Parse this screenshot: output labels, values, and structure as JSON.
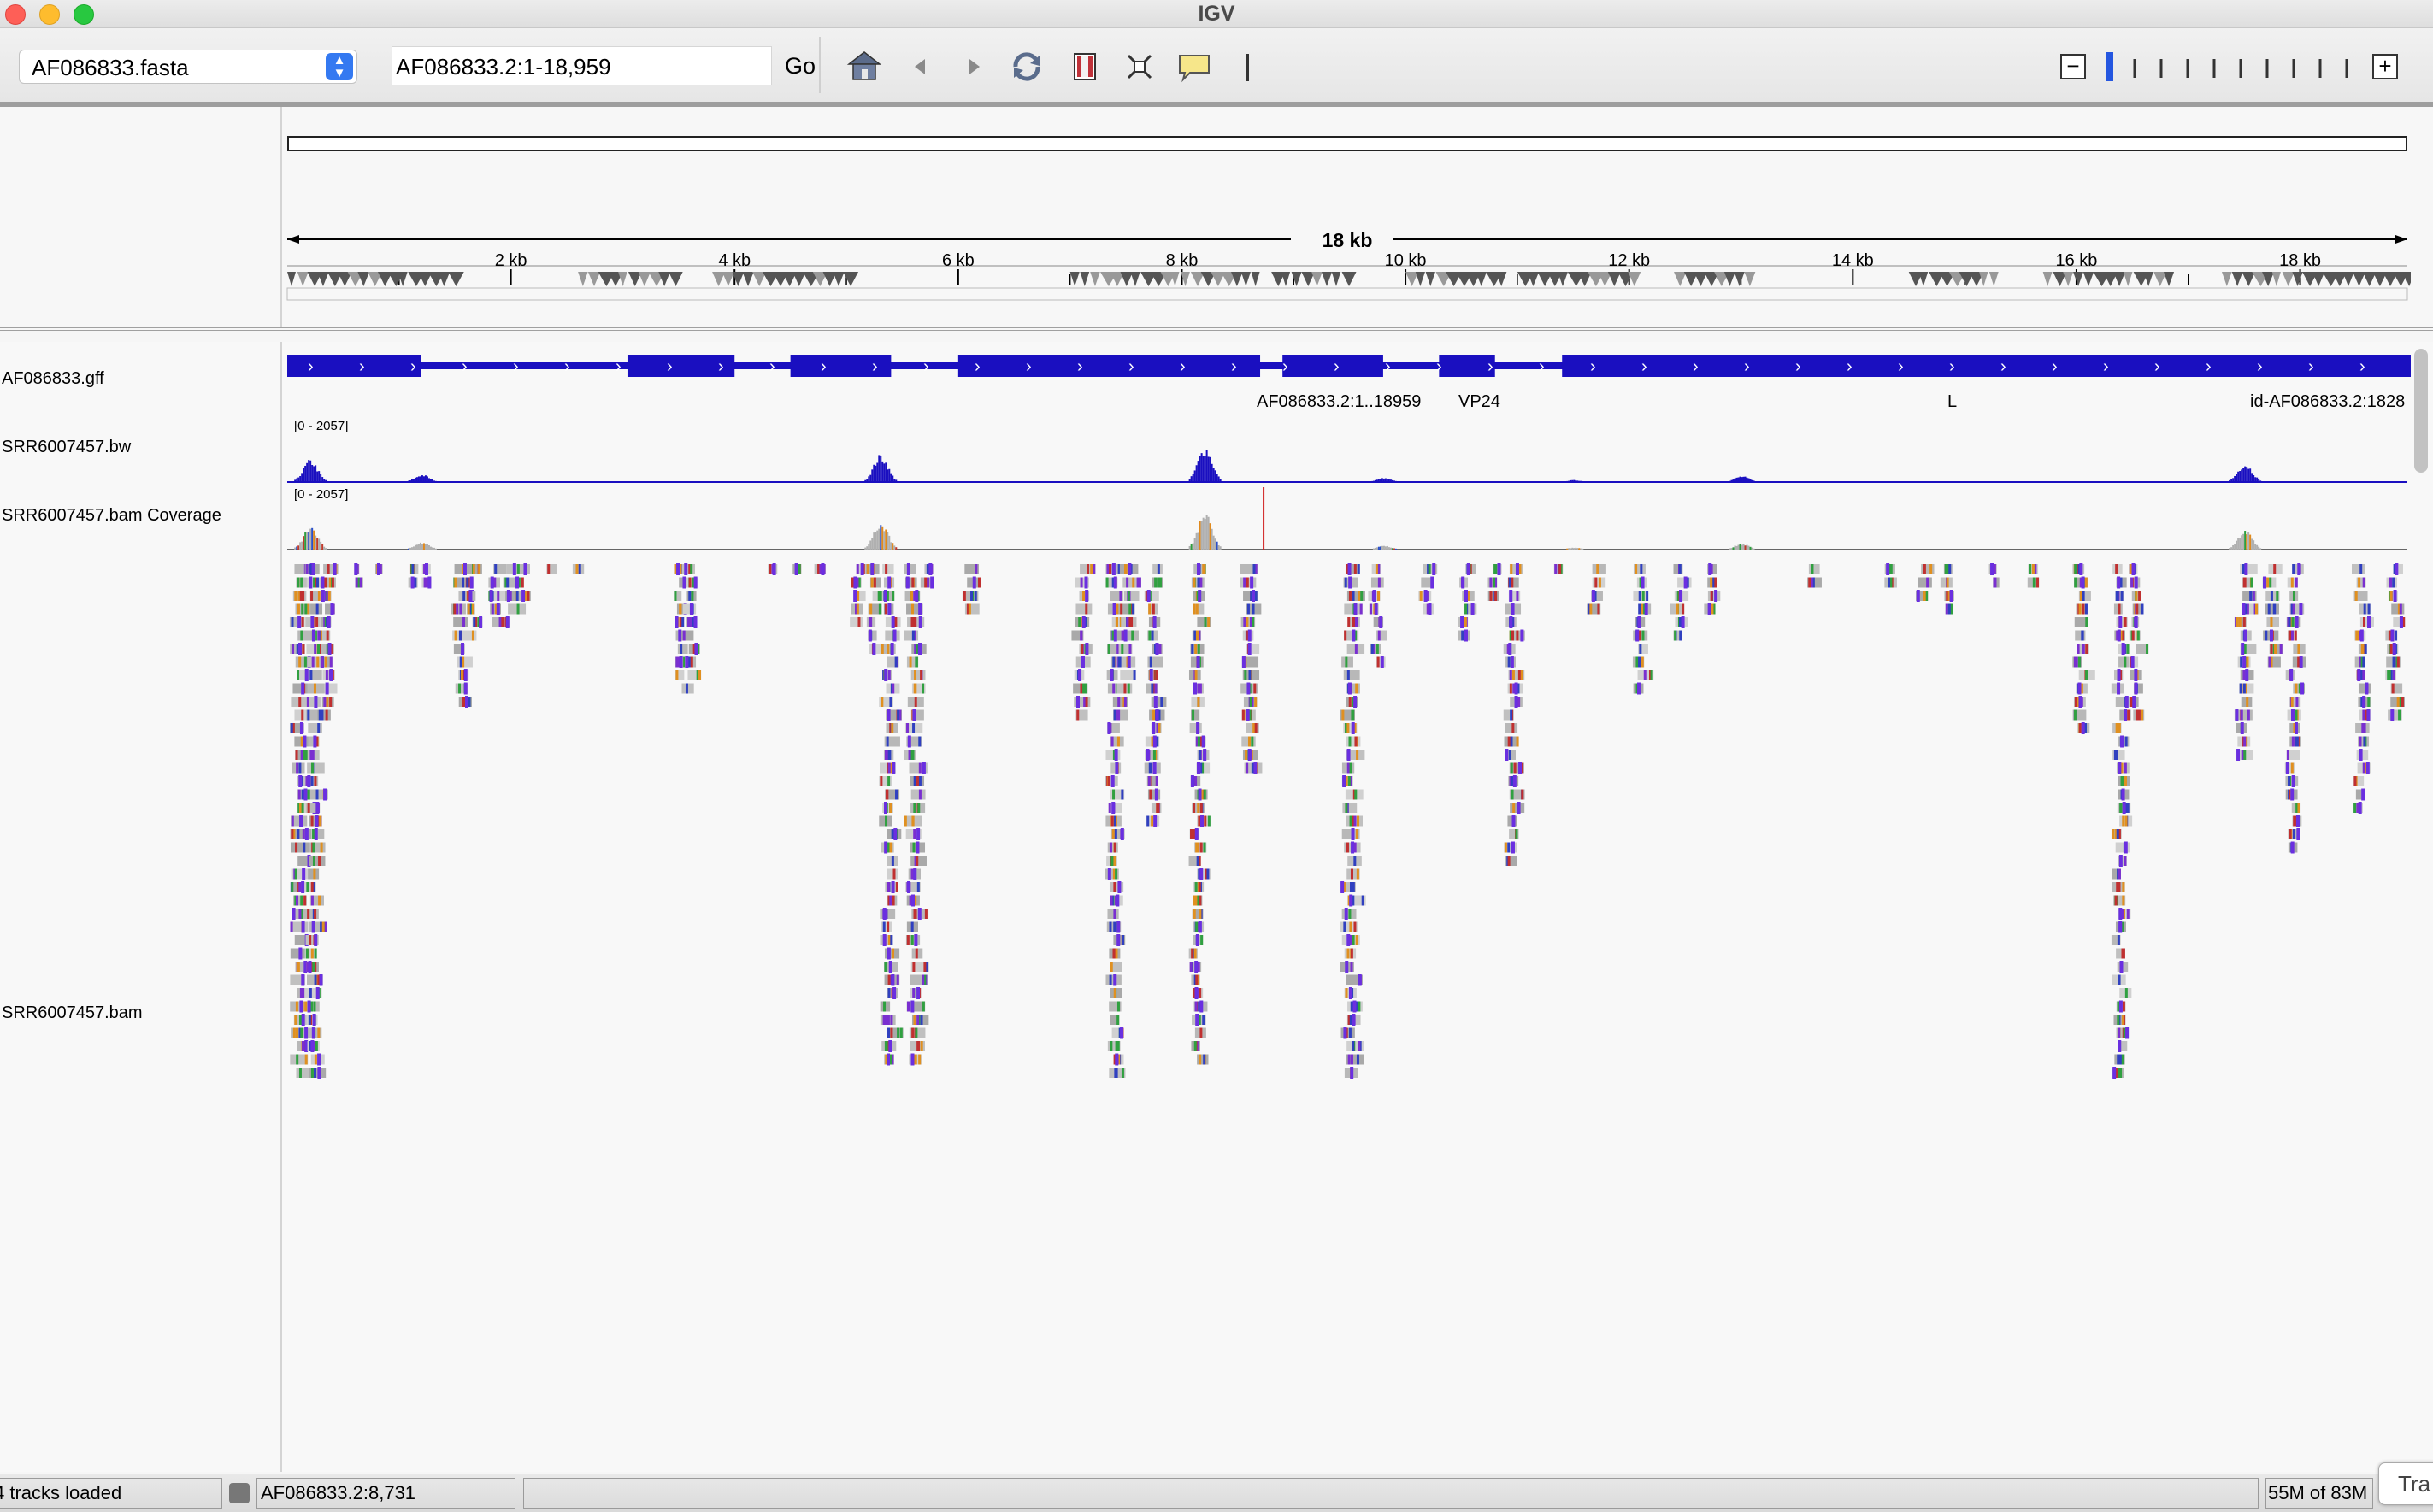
{
  "window": {
    "title": "IGV"
  },
  "toolbar": {
    "genome": "AF086833.fasta",
    "locus": "AF086833.2:1-18,959",
    "go_label": "Go",
    "icons": [
      "home-icon",
      "back-arrow-icon",
      "forward-arrow-icon",
      "refresh-icon",
      "region-of-interest-icon",
      "resize-to-window-icon",
      "popup-info-icon"
    ],
    "zoom_minus": "−",
    "zoom_plus": "+",
    "zoom_level_fraction": 0.0
  },
  "ruler": {
    "span_label": "18 kb",
    "ticks": [
      "2 kb",
      "4 kb",
      "6 kb",
      "8 kb",
      "10 kb",
      "12 kb",
      "14 kb",
      "16 kb",
      "18 kb"
    ],
    "tick_values_bp": [
      2000,
      4000,
      6000,
      8000,
      10000,
      12000,
      14000,
      16000,
      18000
    ],
    "sequence_length_bp": 18959
  },
  "tracks": {
    "gff": {
      "name": "AF086833.gff",
      "labels": [
        "AF086833.2:1..18959",
        "VP24",
        "L",
        "id-AF086833.2:1828"
      ]
    },
    "bigwig": {
      "name": "SRR6007457.bw",
      "range": "[0 - 2057]"
    },
    "coverage": {
      "name": "SRR6007457.bam Coverage",
      "range": "[0 - 2057]"
    },
    "bam": {
      "name": "SRR6007457.bam"
    }
  },
  "status": {
    "tracks_loaded": "4 tracks loaded",
    "position": "AF086833.2:8,731",
    "message": "",
    "memory": "55M of 83M",
    "popup": "Tra"
  },
  "colors": {
    "feature": "#1a0fc0",
    "coverage": "#1a0fc0",
    "insertion": "#6a2fe0"
  }
}
